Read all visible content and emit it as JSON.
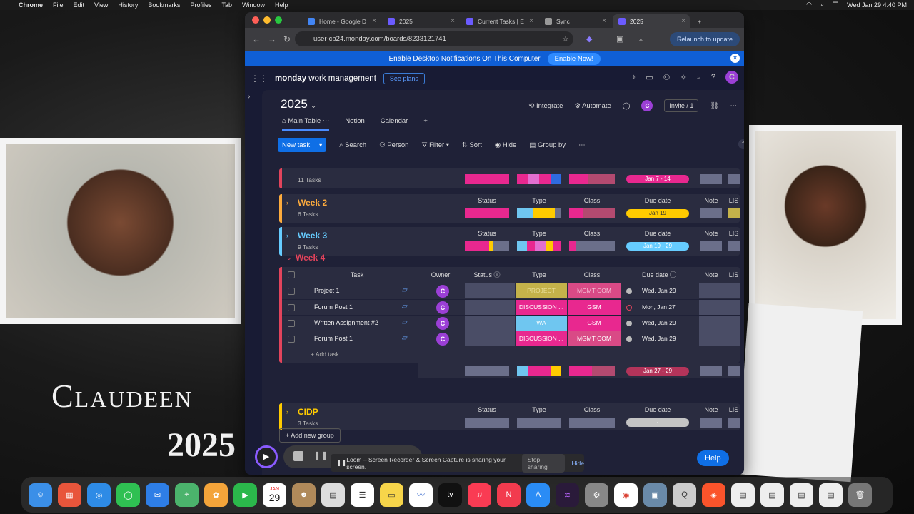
{
  "menubar": {
    "app": "Chrome",
    "items": [
      "File",
      "Edit",
      "View",
      "History",
      "Bookmarks",
      "Profiles",
      "Tab",
      "Window",
      "Help"
    ],
    "datetime": "Wed Jan 29  4:40 PM"
  },
  "desktop": {
    "name": "Claudeen",
    "year": "2025"
  },
  "browser": {
    "tabs": [
      {
        "label": "Home - Google D",
        "icon_color": "#4285f4"
      },
      {
        "label": "2025",
        "icon_color": "#6b5bff"
      },
      {
        "label": "Current Tasks | E",
        "icon_color": "#6b5bff"
      },
      {
        "label": "Sync",
        "icon_color": "#999999"
      },
      {
        "label": "2025",
        "icon_color": "#6b5bff"
      }
    ],
    "url": "user-cb24.monday.com/boards/8233121741",
    "relaunch": "Relaunch to update"
  },
  "notify": {
    "text": "Enable Desktop Notifications On This Computer",
    "button": "Enable Now!"
  },
  "monday": {
    "logo_bold": "monday",
    "logo_rest": " work management",
    "see_plans": "See plans",
    "avatar": "C"
  },
  "board": {
    "title": "2025",
    "integrate": "Integrate",
    "automate": "Automate",
    "invite": "Invite / 1",
    "views": [
      "Main Table",
      "Notion",
      "Calendar"
    ],
    "toolbar": {
      "new_task": "New task",
      "search": "Search",
      "person": "Person",
      "filter": "Filter",
      "sort": "Sort",
      "hide": "Hide",
      "group_by": "Group by"
    },
    "groups": {
      "this_week": {
        "count": "11 Tasks",
        "due": "Jan 7 - 14"
      },
      "week2": {
        "title": "Week 2",
        "count": "6 Tasks",
        "due": "Jan 19"
      },
      "week3": {
        "title": "Week 3",
        "count": "9 Tasks",
        "due": "Jan 19 - 29"
      },
      "week4": {
        "title": "Week 4",
        "due_summary": "Jan 27 - 29"
      },
      "cidp": {
        "title": "CIDP",
        "count": "3 Tasks",
        "due": "-"
      }
    },
    "col_headers": {
      "task": "Task",
      "owner": "Owner",
      "status": "Status",
      "type": "Type",
      "class": "Class",
      "due": "Due date",
      "note": "Note",
      "lis": "LIS"
    },
    "rows": [
      {
        "task": "Project 1",
        "type": "PROJECT",
        "type_color": "#c4b24a",
        "class": "MGMT COM",
        "class_color": "#d94a86",
        "due": "Wed, Jan 29"
      },
      {
        "task": "Forum Post 1",
        "type": "DISCUSSION ...",
        "type_color": "#e8288f",
        "class": "GSM",
        "class_color": "#e8288f",
        "due": "Mon, Jan 27"
      },
      {
        "task": "Written Assignment #2",
        "type": "WA",
        "type_color": "#6fc6f0",
        "class": "GSM",
        "class_color": "#e8288f",
        "due": "Wed, Jan 29"
      },
      {
        "task": "Forum Post 1",
        "type": "DISCUSSION ...",
        "type_color": "#e8288f",
        "class": "MGMT COM",
        "class_color": "#d94a86",
        "due": "Wed, Jan 29"
      }
    ],
    "add_task": "+ Add task",
    "add_group": "Add new group",
    "help": "Help"
  },
  "loom": {
    "text": "Loom – Screen Recorder & Screen Capture is sharing your screen.",
    "stop": "Stop sharing",
    "hide": "Hide"
  },
  "dock": {
    "calendar_day": "29",
    "calendar_month": "JAN"
  }
}
